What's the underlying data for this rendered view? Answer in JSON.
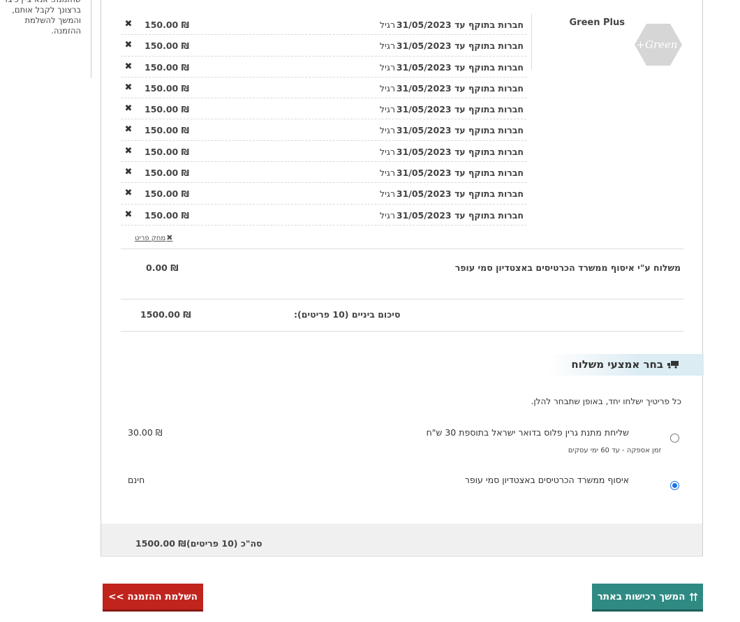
{
  "side_note": {
    "text": "שהזמנת. אנא ציין כיצד ברצונך לקבל אותם, והמשך להשלמת ההזמנה."
  },
  "product": {
    "name": "Green Plus",
    "logo_text": "Green+"
  },
  "items": [
    {
      "desc": "חברות בתוקף עד 31/05/2023",
      "type": "רגיל",
      "price": "150.00 ₪"
    },
    {
      "desc": "חברות בתוקף עד 31/05/2023",
      "type": "רגיל",
      "price": "150.00 ₪"
    },
    {
      "desc": "חברות בתוקף עד 31/05/2023",
      "type": "רגיל",
      "price": "150.00 ₪"
    },
    {
      "desc": "חברות בתוקף עד 31/05/2023",
      "type": "רגיל",
      "price": "150.00 ₪"
    },
    {
      "desc": "חברות בתוקף עד 31/05/2023",
      "type": "רגיל",
      "price": "150.00 ₪"
    },
    {
      "desc": "חברות בתוקף עד 31/05/2023",
      "type": "רגיל",
      "price": "150.00 ₪"
    },
    {
      "desc": "חברות בתוקף עד 31/05/2023",
      "type": "רגיל",
      "price": "150.00 ₪"
    },
    {
      "desc": "חברות בתוקף עד 31/05/2023",
      "type": "רגיל",
      "price": "150.00 ₪"
    },
    {
      "desc": "חברות בתוקף עד 31/05/2023",
      "type": "רגיל",
      "price": "150.00 ₪"
    },
    {
      "desc": "חברות בתוקף עד 31/05/2023",
      "type": "רגיל",
      "price": "150.00 ₪"
    }
  ],
  "remove_item_label": "מחק פריט",
  "shipping_line": {
    "label": "משלוח ע\"י איסוף ממשרד הכרטיסים באצטדיון סמי עופר",
    "value": "0.00 ₪"
  },
  "subtotal": {
    "label": "סיכום ביניים (10 פריטים):",
    "value": "1500.00 ₪"
  },
  "delivery": {
    "title": "בחר אמצעי משלוח",
    "note": "כל פריטיך ישלחו יחד, באופן שתבחר להלן.",
    "options": [
      {
        "label": "שליחת מתנת גרין פלוס בדואר ישראל בתוספת 30 ש\"ח",
        "sub": "זמן אספקה - עד 60 ימי עסקים",
        "price": "30.00 ₪",
        "selected": false
      },
      {
        "label": "איסוף ממשרד הכרטיסים באצטדיון סמי עופר",
        "sub": "",
        "price": "חינם",
        "selected": true
      }
    ]
  },
  "total": {
    "label": "סה\"כ (10 פריטים)",
    "value": "1500.00 ₪"
  },
  "buttons": {
    "checkout": "השלמת ההזמנה >>",
    "continue": "המשך רכישות באתר"
  },
  "colors": {
    "checkout_button": "#c0241d",
    "continue_button": "#2e8a82",
    "delivery_header_bg": "#dbecf3",
    "total_bar_bg": "#f0f0f0"
  }
}
